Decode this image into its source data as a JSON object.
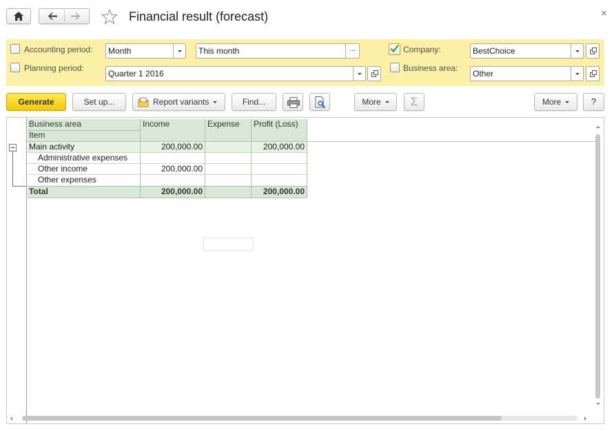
{
  "window": {
    "title": "Financial result (forecast)",
    "close_glyph": "×"
  },
  "filters": {
    "accounting_period": {
      "label": "Accounting period:",
      "checked": false,
      "value": "Month",
      "range_value": "This month",
      "dots": "..."
    },
    "planning_period": {
      "label": "Planning period:",
      "checked": false,
      "value": "Quarter 1 2016"
    },
    "company": {
      "label": "Company:",
      "checked": true,
      "value": "BestChoice"
    },
    "business_area": {
      "label": "Business area:",
      "checked": false,
      "value": "Other"
    }
  },
  "toolbar": {
    "generate": "Generate",
    "setup": "Set up...",
    "report_variants": "Report variants",
    "find": "Find...",
    "more_left": "More",
    "sum_glyph": "Σ",
    "more_right": "More",
    "help": "?"
  },
  "report": {
    "header": {
      "business_area": "Business area",
      "item": "Item",
      "income": "Income",
      "expense": "Expense",
      "profit_loss": "Profit (Loss)"
    },
    "group": {
      "label": "Main activity",
      "income": "200,000.00",
      "expense": "",
      "profit": "200,000.00",
      "collapse_glyph": "−"
    },
    "rows": [
      {
        "label": "Administrative expenses",
        "income": "",
        "expense": "",
        "profit": ""
      },
      {
        "label": "Other income",
        "income": "200,000.00",
        "expense": "",
        "profit": ""
      },
      {
        "label": "Other expenses",
        "income": "",
        "expense": "",
        "profit": ""
      }
    ],
    "total": {
      "label": "Total",
      "income": "200,000.00",
      "expense": "",
      "profit": "200,000.00"
    }
  },
  "colors": {
    "filter_background": "#fbf0a6",
    "generate_button": "#f7d81a",
    "header_green": "#d8e7d6",
    "group_green": "#e6f3e3"
  }
}
